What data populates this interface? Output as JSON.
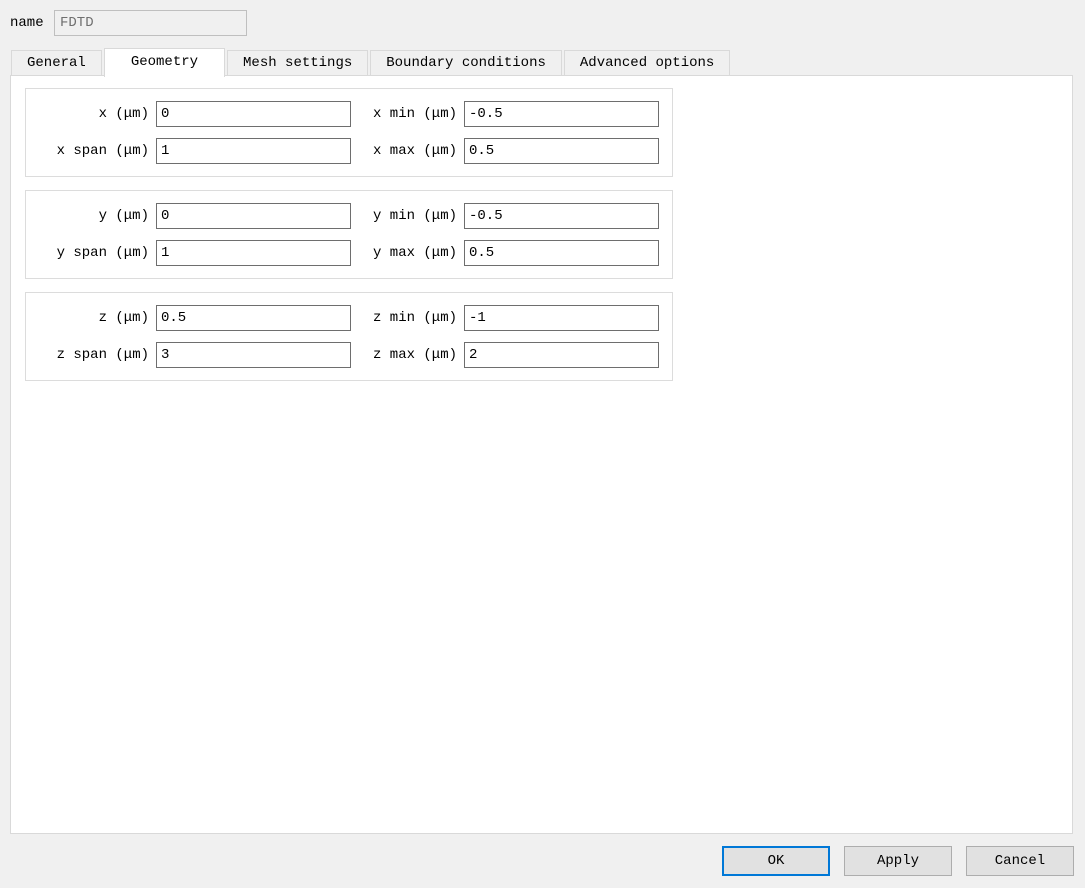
{
  "colors": {
    "window_bg": "#f0f0f0",
    "panel_bg": "#ffffff",
    "accent_default_button": "#0078d7",
    "button_face": "#e1e1e1",
    "input_border": "#6e6e6e"
  },
  "name_field": {
    "label": "name",
    "value": "FDTD"
  },
  "tabs": [
    {
      "label": "General",
      "active": false
    },
    {
      "label": "Geometry",
      "active": true
    },
    {
      "label": "Mesh settings",
      "active": false
    },
    {
      "label": "Boundary conditions",
      "active": false
    },
    {
      "label": "Advanced options",
      "active": false
    }
  ],
  "geometry": {
    "groups": [
      {
        "axis": "x",
        "fields": [
          {
            "label": "x (μm)",
            "value": "0"
          },
          {
            "label": "x min (μm)",
            "value": "-0.5"
          },
          {
            "label": "x span (μm)",
            "value": "1"
          },
          {
            "label": "x max (μm)",
            "value": "0.5"
          }
        ]
      },
      {
        "axis": "y",
        "fields": [
          {
            "label": "y (μm)",
            "value": "0"
          },
          {
            "label": "y min (μm)",
            "value": "-0.5"
          },
          {
            "label": "y span (μm)",
            "value": "1"
          },
          {
            "label": "y max (μm)",
            "value": "0.5"
          }
        ]
      },
      {
        "axis": "z",
        "fields": [
          {
            "label": "z (μm)",
            "value": "0.5"
          },
          {
            "label": "z min (μm)",
            "value": "-1"
          },
          {
            "label": "z span (μm)",
            "value": "3"
          },
          {
            "label": "z max (μm)",
            "value": "2"
          }
        ]
      }
    ]
  },
  "buttons": {
    "ok": "OK",
    "apply": "Apply",
    "cancel": "Cancel"
  }
}
